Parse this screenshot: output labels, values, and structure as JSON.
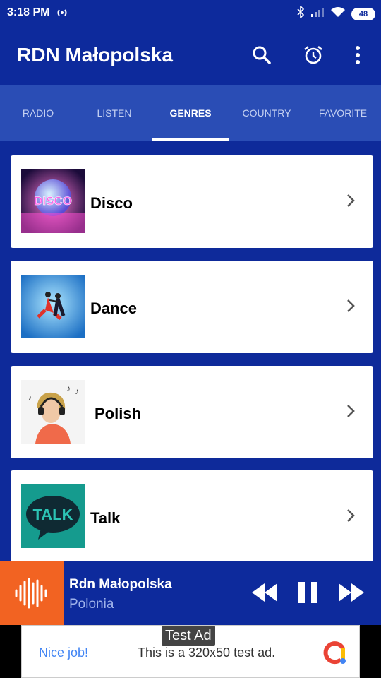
{
  "status": {
    "time": "3:18 PM",
    "battery": "48"
  },
  "appbar": {
    "title": "RDN Małopolska",
    "icons": [
      "search-icon",
      "alarm-icon",
      "more-vert-icon"
    ]
  },
  "tabs": [
    {
      "label": "RADIO"
    },
    {
      "label": "LISTEN"
    },
    {
      "label": "GENRES"
    },
    {
      "label": "COUNTRY"
    },
    {
      "label": "FAVORITE"
    }
  ],
  "active_tab": "GENRES",
  "genres": [
    {
      "label": "Disco"
    },
    {
      "label": "Dance"
    },
    {
      "label": "Polish"
    },
    {
      "label": "Talk"
    }
  ],
  "thumbnail_text": {
    "disco": "DISCO",
    "talk": "TALK"
  },
  "player": {
    "title": "Rdn Małopolska",
    "subtitle": "Polonia"
  },
  "ad": {
    "badge": "Test Ad",
    "nice": "Nice job!",
    "message": "This is a 320x50 test ad."
  },
  "colors": {
    "primary": "#0d2a9c",
    "tabs": "#2a4db5",
    "accent": "#f26322",
    "card": "#ffffff"
  }
}
